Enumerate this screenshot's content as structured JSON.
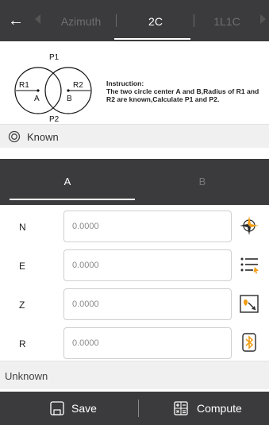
{
  "header": {
    "back_icon": "arrow-left-icon",
    "tabs": [
      {
        "label": "Azimuth",
        "active": false
      },
      {
        "label": "2C",
        "active": true
      },
      {
        "label": "1L1C",
        "active": false
      }
    ]
  },
  "diagram": {
    "labels": {
      "p1": "P1",
      "p2": "P2",
      "r1": "R1",
      "r2": "R2",
      "a": "A",
      "b": "B"
    },
    "instruction_title": "Instruction:",
    "instruction_text": "The two circle center A and B,Radius of R1 and R2 are known,Calculate P1 and P2."
  },
  "known": {
    "icon": "target-icon",
    "label": "Known"
  },
  "point_tabs": [
    {
      "label": "A",
      "active": true
    },
    {
      "label": "B",
      "active": false
    }
  ],
  "fields": [
    {
      "label": "N",
      "placeholder": "0.0000",
      "value": "",
      "icon": "compass-icon"
    },
    {
      "label": "E",
      "placeholder": "0.0000",
      "value": "",
      "icon": "list-select-icon"
    },
    {
      "label": "Z",
      "placeholder": "0.0000",
      "value": "",
      "icon": "map-point-icon"
    },
    {
      "label": "R",
      "placeholder": "0.0000",
      "value": "",
      "icon": "bluetooth-icon"
    }
  ],
  "unknown": {
    "label": "Unknown"
  },
  "footer": {
    "save_label": "Save",
    "save_icon": "save-icon",
    "compute_label": "Compute",
    "compute_icon": "calculator-icon"
  },
  "colors": {
    "bar_bg": "#3b3b3d",
    "section_bg": "#f0f0f0",
    "accent_orange": "#f39c12",
    "accent_blue": "#2b6cd6"
  }
}
